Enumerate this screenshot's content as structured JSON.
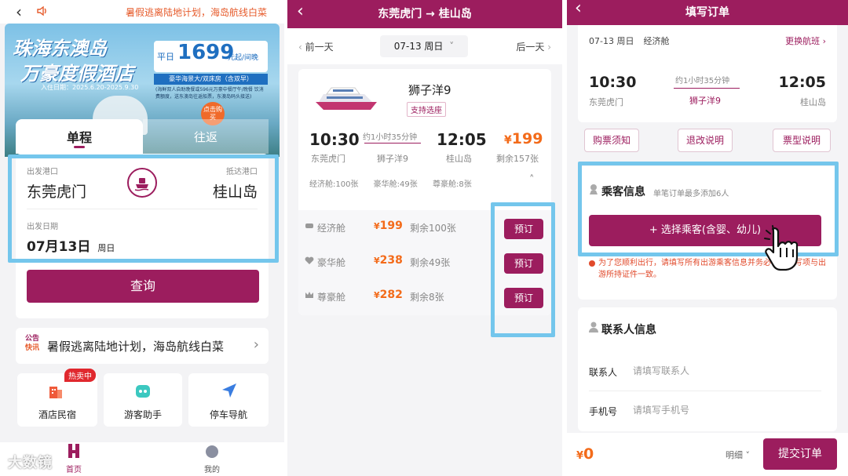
{
  "colors": {
    "brand": "#9c1d5e",
    "price": "#f36b1a",
    "highlight": "#74c6ec",
    "notice": "#e14a2b"
  },
  "p1": {
    "marquee": "暑假逃离陆地计划，海岛航线白菜",
    "banner": {
      "title1": "珠海东澳岛",
      "title2": "万豪度假酒店",
      "dates": "入住日期：2025.6.20-2025.9.30",
      "price_prefix": "平日",
      "price": "1699",
      "price_suffix": "元起/间晚",
      "room": "豪华海景大/双床房（含双早）",
      "desc": "(海鲜双人自助晚餐或596元万豪中餐厅午/晚餐 饮消费额度，送东澳岛往返船票，东澳岛码头接送)",
      "badge": "点击购买"
    },
    "tabs": {
      "one_way": "单程",
      "round_trip": "往返"
    },
    "from_label": "出发港口",
    "from": "东莞虎门",
    "to_label": "抵达港口",
    "to": "桂山岛",
    "date_label": "出发日期",
    "date": "07月13日",
    "weekday": "周日",
    "search": "查询",
    "notice_tag1": "公告",
    "notice_tag2": "快讯",
    "notice": "暑假逃离陆地计划，海岛航线白菜",
    "hot_badge": "热卖中",
    "grid": [
      "酒店民宿",
      "游客助手",
      "停车导航"
    ],
    "bottom_nav": [
      "首页",
      "我的"
    ],
    "watermark": "大数镜"
  },
  "p2": {
    "title": "东莞虎门 → 桂山岛",
    "prev_day": "前一天",
    "date": "07-13 周日",
    "next_day": "后一天",
    "ship": "狮子洋9",
    "seat_tag": "支持选座",
    "depart_time": "10:30",
    "depart_port": "东莞虎门",
    "duration": "约1小时35分钟",
    "ship_small": "狮子洋9",
    "arrive_time": "12:05",
    "arrive_port": "桂山岛",
    "currency": "¥",
    "price": "199",
    "remain": "剩余157张",
    "summary": [
      {
        "label": "经济舱:",
        "value": "100张"
      },
      {
        "label": "豪华舱:",
        "value": "49张"
      },
      {
        "label": "尊豪舱:",
        "value": "8张"
      }
    ],
    "classes": [
      {
        "name": "经济舱",
        "price": "199",
        "remain": "剩余100张",
        "btn": "预订"
      },
      {
        "name": "豪华舱",
        "price": "238",
        "remain": "剩余49张",
        "btn": "预订"
      },
      {
        "name": "尊豪舱",
        "price": "282",
        "remain": "剩余8张",
        "btn": "预订"
      }
    ]
  },
  "p3": {
    "title": "填写订单",
    "date": "07-13 周日",
    "cabin": "经济舱",
    "change": "更换航班",
    "depart_time": "10:30",
    "depart_port": "东莞虎门",
    "duration": "约1小时35分钟",
    "ship": "狮子洋9",
    "arrive_time": "12:05",
    "arrive_port": "桂山岛",
    "buttons": [
      "购票须知",
      "退改说明",
      "票型说明"
    ],
    "passenger_title": "乘客信息",
    "passenger_hint": "单笔订单最多添加6人",
    "select_btn": "+ 选择乘客(含婴、幼儿)",
    "warning": "为了您顺利出行，请填写所有出游乘客信息并务必保证填写项与出游所持证件一致。",
    "contact_title": "联系人信息",
    "contact_label": "联系人",
    "contact_ph": "请填写联系人",
    "phone_label": "手机号",
    "phone_ph": "请填写手机号",
    "total_currency": "¥",
    "total": "0",
    "detail": "明细",
    "submit": "提交订单"
  }
}
